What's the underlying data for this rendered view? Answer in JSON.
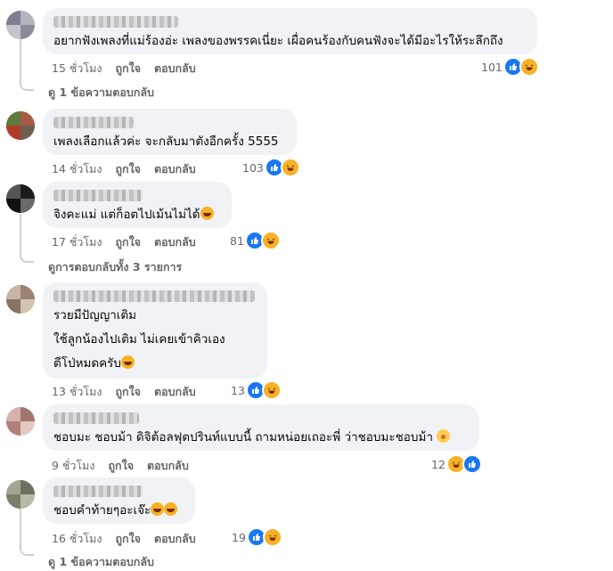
{
  "comments": [
    {
      "text_lines": [
        "อยากฟังเพลงที่แม่ร้องอ่ะ เพลงของพรรคเนี่ยะ เผื่อคนร้องกับคนฟังจะได้มีอะไรให้ระลึกถึง"
      ],
      "time": "15 ชั่วโมง",
      "like": "ถูกใจ",
      "reply": "ตอบกลับ",
      "reaction_count": "101",
      "reaction_icons": [
        "like-icon",
        "haha-icon"
      ],
      "view_replies": "ดู 1 ข้อความตอบกลับ"
    },
    {
      "text_lines": [
        "เพลงเลือกแล้วค่ะ จะกลับมาตังอีกครั้ง 5555"
      ],
      "time": "14 ชั่วโมง",
      "like": "ถูกใจ",
      "reply": "ตอบกลับ",
      "reaction_count": "103",
      "reaction_icons": [
        "like-icon",
        "haha-icon"
      ]
    },
    {
      "text_lines": [
        "จิงคะแม่ แต่ก็อตไปเม้นไม่ได้"
      ],
      "time": "17 ชั่วโมง",
      "like": "ถูกใจ",
      "reply": "ตอบกลับ",
      "reaction_count": "81",
      "reaction_icons": [
        "like-icon",
        "haha-icon"
      ],
      "view_replies": "ดูการตอบกลับทั้ง 3 รายการ"
    },
    {
      "text_lines": [
        "รวยมีปัญญาเติม",
        "ใช้ลูกน้องไปเติม ไม่เคยเข้าคิวเอง",
        "ตีโป่หมดครับ"
      ],
      "time": "13 ชั่วโมง",
      "like": "ถูกใจ",
      "reply": "ตอบกลับ",
      "reaction_count": "13",
      "reaction_icons": [
        "like-icon",
        "haha-icon"
      ]
    },
    {
      "text_lines": [
        "ชอบมะ ชอบม้า ดิจิต้อลฟุตปรินท์แบบนี้ ถามหน่อยเถอะพี่ ว่าชอบมะชอบม้า"
      ],
      "time": "9 ชั่วโมง",
      "like": "ถูกใจ",
      "reply": "ตอบกลับ",
      "reaction_count": "12",
      "reaction_icons": [
        "haha-icon",
        "like-icon"
      ]
    },
    {
      "text_lines": [
        "ชอบคำท้ายๆอะเจ๊ะ"
      ],
      "time": "16 ชั่วโมง",
      "like": "ถูกใจ",
      "reply": "ตอบกลับ",
      "reaction_count": "19",
      "reaction_icons": [
        "like-icon",
        "haha-icon"
      ],
      "view_replies": "ดู 1 ข้อความตอบกลับ"
    }
  ],
  "colors": {
    "bubble": "#f0f2f5",
    "meta": "#65676b",
    "like": "#1877f2",
    "haha": "#f7b125"
  }
}
